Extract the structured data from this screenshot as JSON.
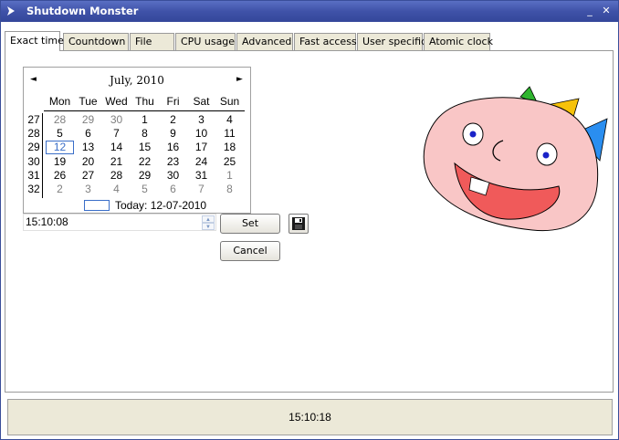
{
  "window": {
    "title": "Shutdown Monster",
    "minimize_glyph": "_",
    "close_glyph": "✕"
  },
  "tabs": [
    {
      "label": "Exact time",
      "active": true
    },
    {
      "label": "Countdown",
      "active": false
    },
    {
      "label": "File",
      "active": false
    },
    {
      "label": "CPU usage",
      "active": false
    },
    {
      "label": "Advanced",
      "active": false
    },
    {
      "label": "Fast access",
      "active": false
    },
    {
      "label": "User specific",
      "active": false
    },
    {
      "label": "Atomic clock",
      "active": false
    }
  ],
  "calendar": {
    "month_label": "July, 2010",
    "prev_glyph": "◄",
    "next_glyph": "►",
    "weekdays": [
      "Mon",
      "Tue",
      "Wed",
      "Thu",
      "Fri",
      "Sat",
      "Sun"
    ],
    "weeks": [
      {
        "week": "27",
        "days": [
          {
            "d": "28",
            "muted": true
          },
          {
            "d": "29",
            "muted": true
          },
          {
            "d": "30",
            "muted": true
          },
          {
            "d": "1"
          },
          {
            "d": "2"
          },
          {
            "d": "3"
          },
          {
            "d": "4"
          }
        ]
      },
      {
        "week": "28",
        "days": [
          {
            "d": "5"
          },
          {
            "d": "6"
          },
          {
            "d": "7"
          },
          {
            "d": "8"
          },
          {
            "d": "9"
          },
          {
            "d": "10"
          },
          {
            "d": "11"
          }
        ]
      },
      {
        "week": "29",
        "days": [
          {
            "d": "12",
            "selected": true
          },
          {
            "d": "13"
          },
          {
            "d": "14"
          },
          {
            "d": "15"
          },
          {
            "d": "16"
          },
          {
            "d": "17"
          },
          {
            "d": "18"
          }
        ]
      },
      {
        "week": "30",
        "days": [
          {
            "d": "19"
          },
          {
            "d": "20"
          },
          {
            "d": "21"
          },
          {
            "d": "22"
          },
          {
            "d": "23"
          },
          {
            "d": "24"
          },
          {
            "d": "25"
          }
        ]
      },
      {
        "week": "31",
        "days": [
          {
            "d": "26"
          },
          {
            "d": "27"
          },
          {
            "d": "28"
          },
          {
            "d": "29"
          },
          {
            "d": "30"
          },
          {
            "d": "31"
          },
          {
            "d": "1",
            "muted": true
          }
        ]
      },
      {
        "week": "32",
        "days": [
          {
            "d": "2",
            "muted": true
          },
          {
            "d": "3",
            "muted": true
          },
          {
            "d": "4",
            "muted": true
          },
          {
            "d": "5",
            "muted": true
          },
          {
            "d": "6",
            "muted": true
          },
          {
            "d": "7",
            "muted": true
          },
          {
            "d": "8",
            "muted": true
          }
        ]
      }
    ],
    "today_label": "Today: 12-07-2010"
  },
  "time_input": {
    "value": "15:10:08"
  },
  "buttons": {
    "set_label": "Set",
    "cancel_label": "Cancel"
  },
  "status": {
    "clock": "15:10:18"
  },
  "colors": {
    "titlebar": "#3f52a8",
    "face": "#f9c6c6",
    "mouth": "#f05a5a",
    "spike_green": "#2fb52f",
    "spike_yellow": "#f6c20a",
    "spike_blue": "#2a8ef0",
    "eye_pupil": "#1a22c8",
    "selection": "#3a6ec8"
  }
}
